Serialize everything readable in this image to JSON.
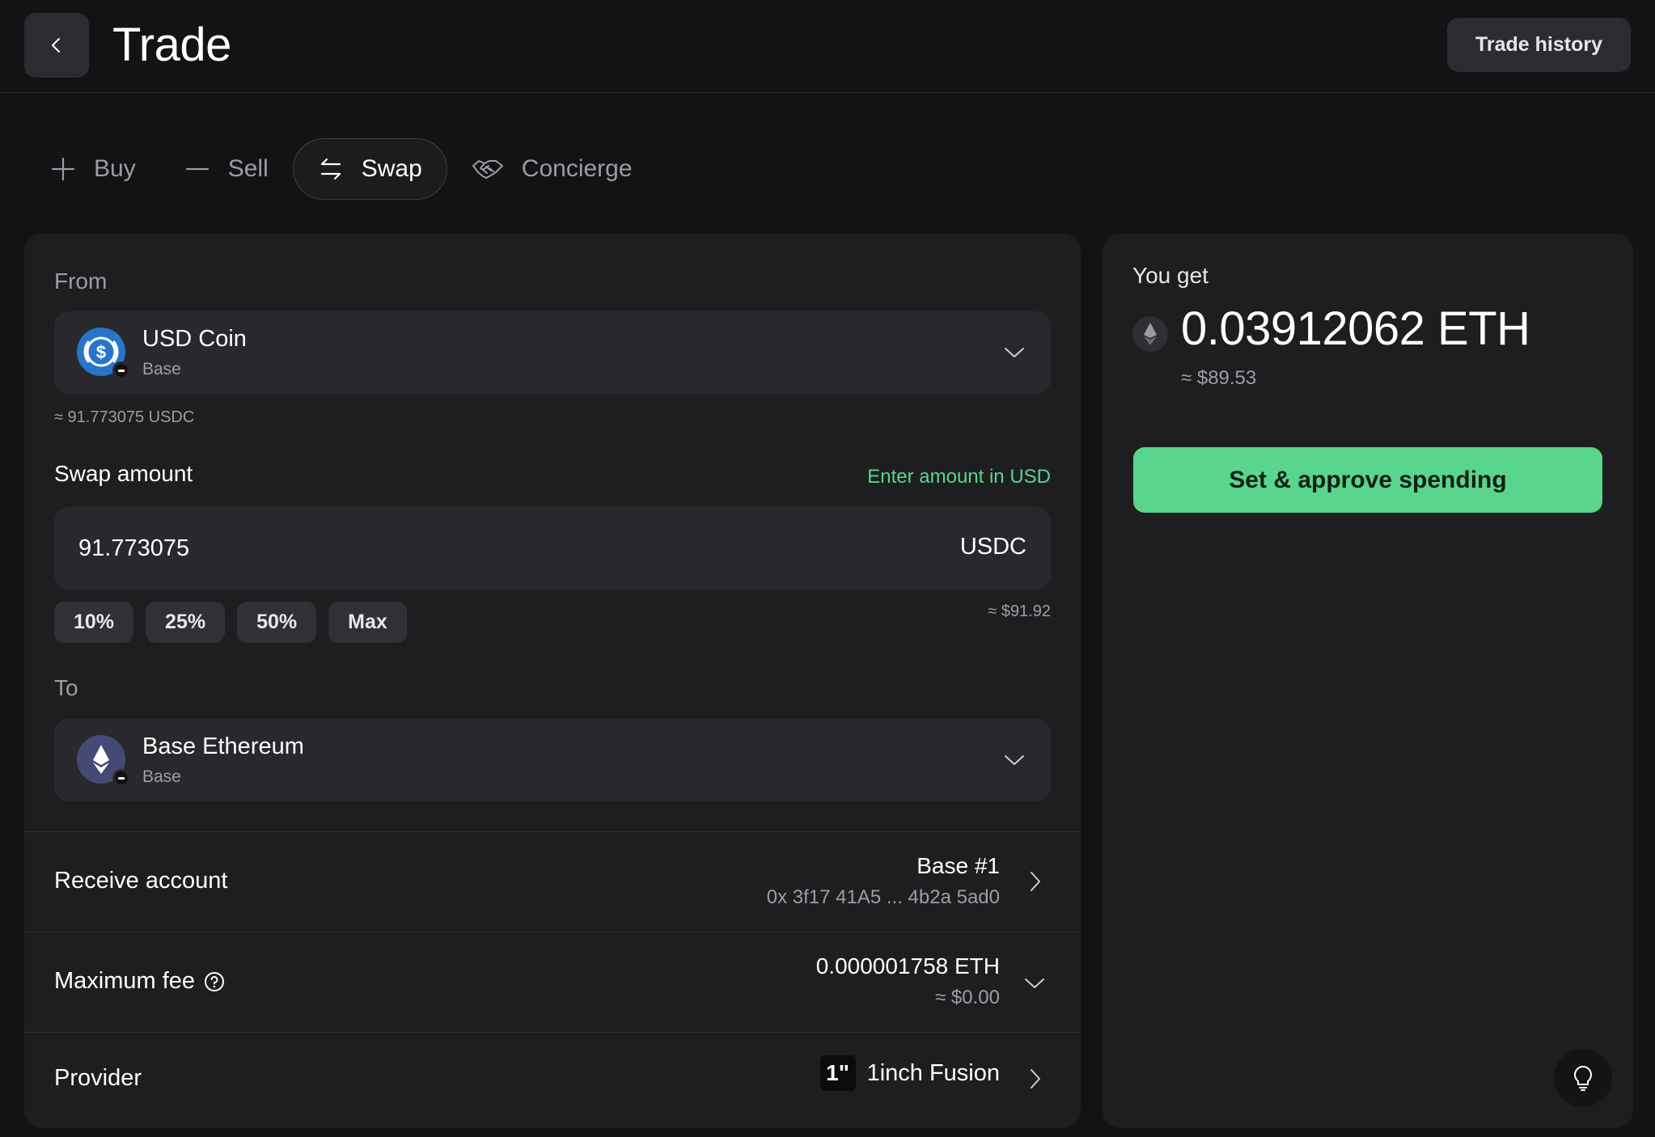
{
  "header": {
    "title": "Trade",
    "trade_history_label": "Trade history"
  },
  "tabs": [
    {
      "label": "Buy",
      "icon": "plus-icon",
      "active": false
    },
    {
      "label": "Sell",
      "icon": "minus-icon",
      "active": false
    },
    {
      "label": "Swap",
      "icon": "swap-arrows-icon",
      "active": true
    },
    {
      "label": "Concierge",
      "icon": "handshake-icon",
      "active": false
    }
  ],
  "from": {
    "label": "From",
    "token_name": "USD Coin",
    "token_network": "Base",
    "balance": "≈ 91.773075 USDC"
  },
  "swap_amount": {
    "label": "Swap amount",
    "toggle_label": "Enter amount in USD",
    "value": "91.773075",
    "unit": "USDC",
    "usd_value": "≈ $91.92",
    "percent_buttons": [
      "10%",
      "25%",
      "50%",
      "Max"
    ]
  },
  "to": {
    "label": "To",
    "token_name": "Base Ethereum",
    "token_network": "Base"
  },
  "receive_account": {
    "label": "Receive account",
    "account_name": "Base #1",
    "address": "0x 3f17 41A5 ... 4b2a 5ad0"
  },
  "maximum_fee": {
    "label": "Maximum fee",
    "value": "0.000001758 ETH",
    "usd_value": "≈ $0.00"
  },
  "provider": {
    "label": "Provider",
    "logo_text": "1\"",
    "name": "1inch Fusion"
  },
  "summary": {
    "label": "You get",
    "amount": "0.03912062 ETH",
    "usd_value": "≈ $89.53",
    "button_label": "Set & approve spending"
  },
  "colors": {
    "accent_green": "#5ad58d",
    "usdc_blue": "#2775ca",
    "eth_purple": "#454a75"
  }
}
